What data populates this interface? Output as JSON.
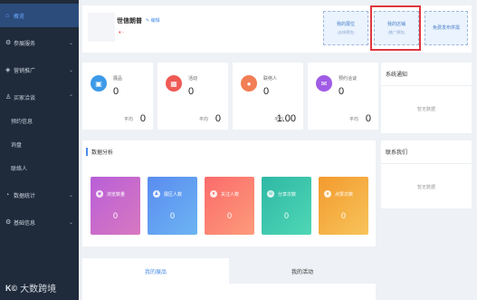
{
  "sidebar": {
    "items": [
      {
        "icon": "home-icon",
        "label": "概览",
        "active": true
      },
      {
        "icon": "settings-icon",
        "label": "参展服务",
        "chev": "⌄"
      },
      {
        "icon": "megaphone-icon",
        "label": "营销推广",
        "chev": "⌄"
      },
      {
        "icon": "user-icon",
        "label": "买家洽谈",
        "chev": "⌃"
      }
    ],
    "subitems": [
      "预约信息",
      "询盘",
      "联络人"
    ],
    "items2": [
      {
        "icon": "chart-icon",
        "label": "数据统计",
        "chev": "⌄"
      },
      {
        "icon": "settings-icon",
        "label": "基础信息",
        "chev": "⌄"
      }
    ],
    "logo_mark": "K©",
    "logo_text": "大数跨境"
  },
  "header": {
    "shop_name": "世信朗普",
    "edit_label": "编辑",
    "location": "♦ -",
    "buttons": [
      {
        "label": "我的展位",
        "sub": "(去线预览)"
      },
      {
        "label": "我的店铺",
        "sub": "(推广预览)"
      },
      {
        "label": "免费发布供需",
        "sub": ""
      }
    ]
  },
  "stats": [
    {
      "title": "展品",
      "value": "0",
      "avg_label": "平均",
      "avg_value": "0",
      "color": "#3d9ae8",
      "icon": "cube-icon"
    },
    {
      "title": "活动",
      "value": "0",
      "avg_label": "平均",
      "avg_value": "0",
      "color": "#ef5a55",
      "icon": "gift-icon"
    },
    {
      "title": "联络人",
      "value": "0",
      "avg_label": "平均",
      "avg_value": "1.00",
      "color": "#f27e55",
      "icon": "person-icon"
    },
    {
      "title": "预约洽谈",
      "value": "0",
      "avg_label": "平均",
      "avg_value": "0",
      "color": "#a05ce5",
      "icon": "chat-icon"
    }
  ],
  "analysis": {
    "title": "数据分析",
    "cards": [
      {
        "label": "浏览数量",
        "value": "0",
        "color1": "#b85fd8",
        "color2": "#d878c0",
        "icon": "eye-icon"
      },
      {
        "label": "展区人数",
        "value": "0",
        "color1": "#5a8cf0",
        "color2": "#6cb4f2",
        "icon": "people-icon"
      },
      {
        "label": "关注人数",
        "value": "0",
        "color1": "#fb6b6b",
        "color2": "#fd9b7b",
        "icon": "heart-icon"
      },
      {
        "label": "分享次数",
        "value": "0",
        "color1": "#2fb8a5",
        "color2": "#4fd7b5",
        "icon": "share-icon"
      },
      {
        "label": "点赞次数",
        "value": "0",
        "color1": "#f39a2e",
        "color2": "#f7c45b",
        "icon": "thumb-icon"
      }
    ]
  },
  "panels": [
    {
      "title": "系统通知",
      "empty": "暂无数据"
    },
    {
      "title": "联系我们",
      "empty": "暂无数据"
    }
  ],
  "tabs": [
    "我的展品",
    "我的活动"
  ]
}
